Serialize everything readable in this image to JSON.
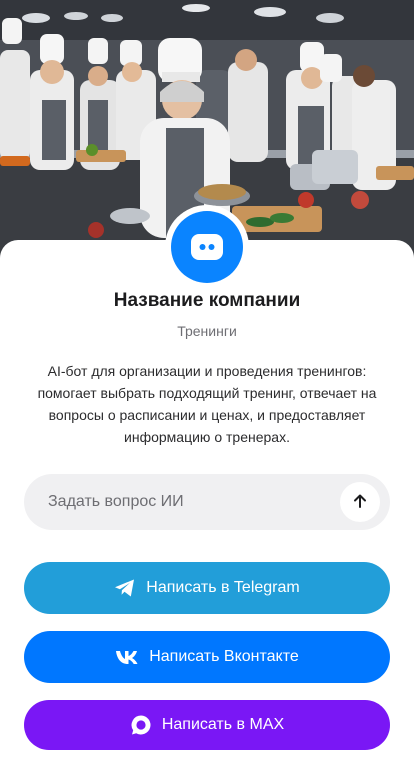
{
  "company": {
    "name": "Название компании",
    "category": "Тренинги",
    "description": "AI-бот для организации и проведения тренингов: помогает выбрать подходящий тренинг, отвечает на вопросы о расписании и ценах, и предоставляет информацию о тренерах."
  },
  "ask": {
    "placeholder": "Задать вопрос ИИ",
    "send_icon": "arrow-up-icon"
  },
  "buttons": {
    "telegram": {
      "label": "Написать в Telegram",
      "icon": "telegram-icon",
      "color": "#229ed9"
    },
    "vk": {
      "label": "Написать Вконтакте",
      "icon": "vk-icon",
      "color": "#0077ff"
    },
    "max": {
      "label": "Написать в MAX",
      "icon": "max-icon",
      "color": "#7a17f5"
    }
  },
  "colors": {
    "accent": "#0a84ff"
  }
}
